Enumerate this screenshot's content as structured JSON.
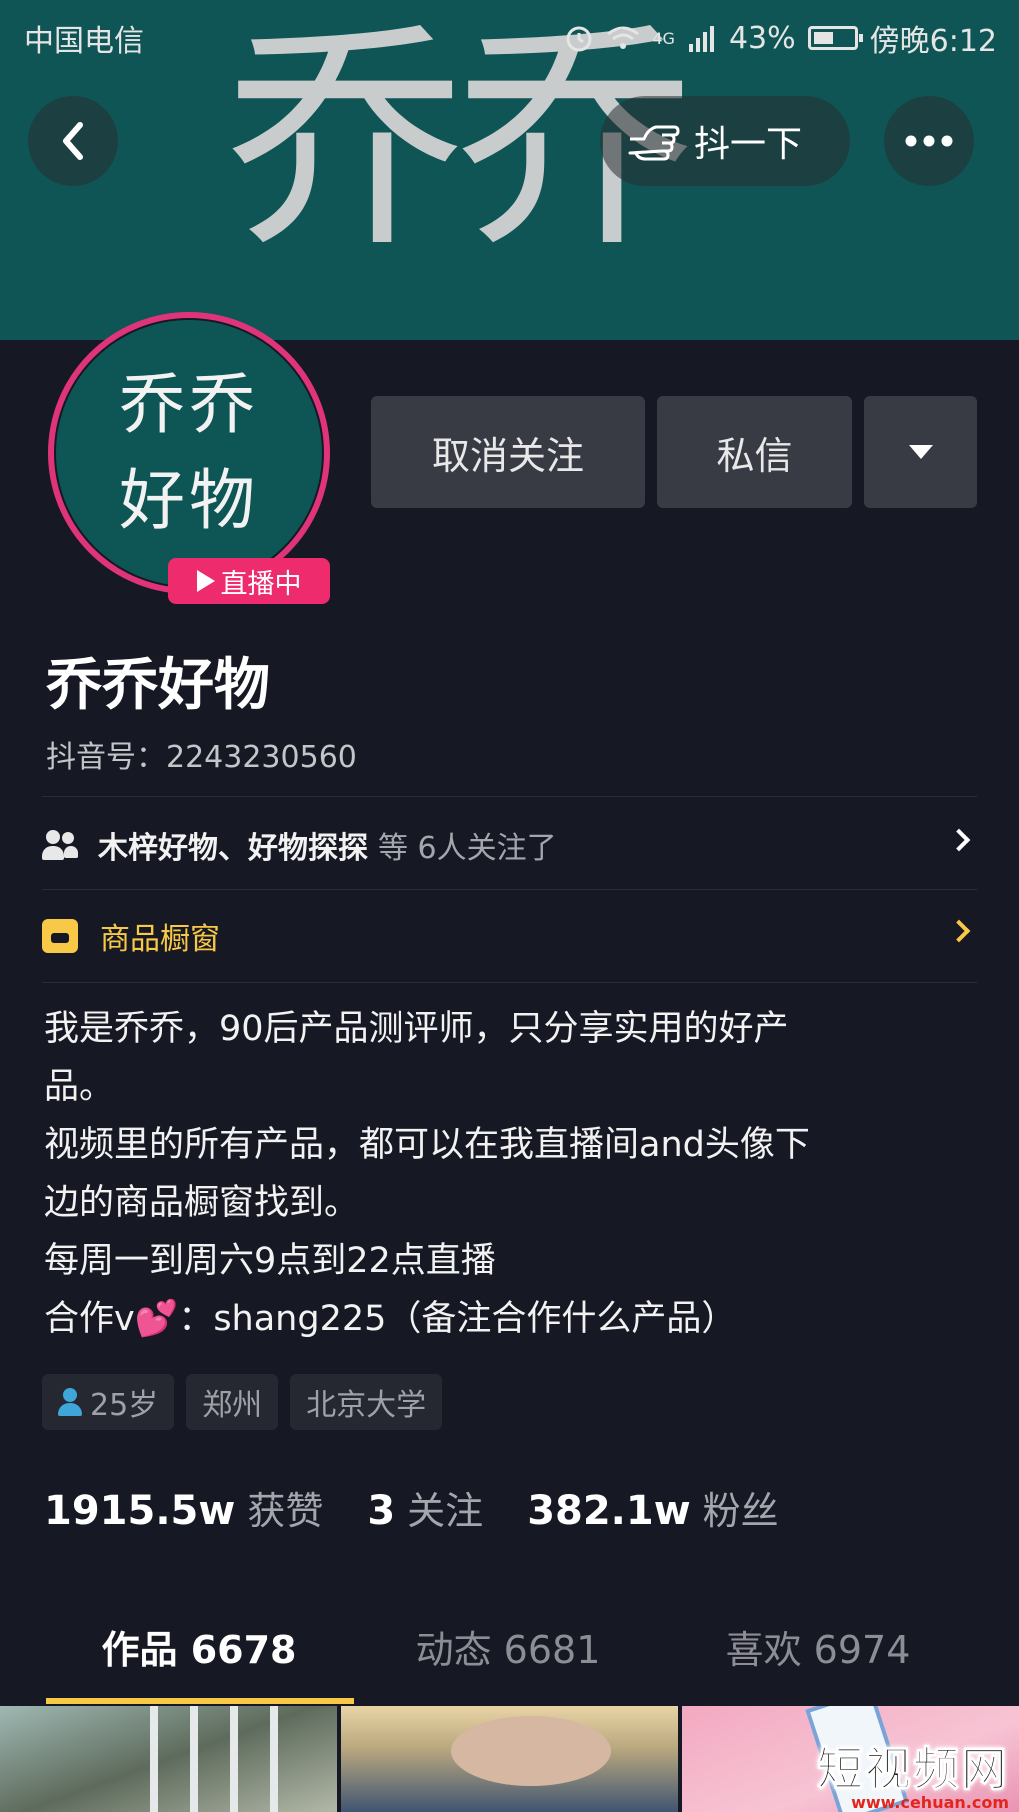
{
  "status_bar": {
    "carrier": "中国电信",
    "network": "4G",
    "battery": "43%",
    "time": "傍晚6:12"
  },
  "banner": {
    "text": "乔乔"
  },
  "header": {
    "shake_label": "抖一下"
  },
  "profile": {
    "avatar_lines": [
      "乔乔",
      "好物"
    ],
    "live_badge": "直播中",
    "nickname": "乔乔好物",
    "douyin_id": "抖音号：2243230560"
  },
  "actions": {
    "unfollow_label": "取消关注",
    "message_label": "私信"
  },
  "followed_by": {
    "names": "木梓好物、好物探探",
    "rest": "等 6人关注了"
  },
  "shop": {
    "label": "商品橱窗"
  },
  "bio": {
    "line1": "我是乔乔，90后产品测评师，只分享实用的好产",
    "line2": "品。",
    "line3": "视频里的所有产品，都可以在我直播间and头像下",
    "line4": "边的商品橱窗找到。",
    "line5": "每周一到周六9点到22点直播",
    "line6_prefix": "合作v",
    "line6_emoji": "💕",
    "line6_suffix": "：shang225（备注合作什么产品）"
  },
  "tags": {
    "age": "25岁",
    "city": "郑州",
    "school": "北京大学"
  },
  "stats": {
    "likes_num": "1915.5w",
    "likes_label": "获赞",
    "following_num": "3",
    "following_label": "关注",
    "fans_num": "382.1w",
    "fans_label": "粉丝"
  },
  "tabs": {
    "works": "作品 6678",
    "dynamics": "动态 6681",
    "likes": "喜欢 6974"
  },
  "watermark": {
    "text": "短视频网",
    "url": "www.cehuan.com"
  },
  "colors": {
    "background": "#161823",
    "banner": "#0f5556",
    "accent_yellow": "#f7c947",
    "live_pink": "#ed2b6d",
    "button_gray": "#393b44"
  }
}
